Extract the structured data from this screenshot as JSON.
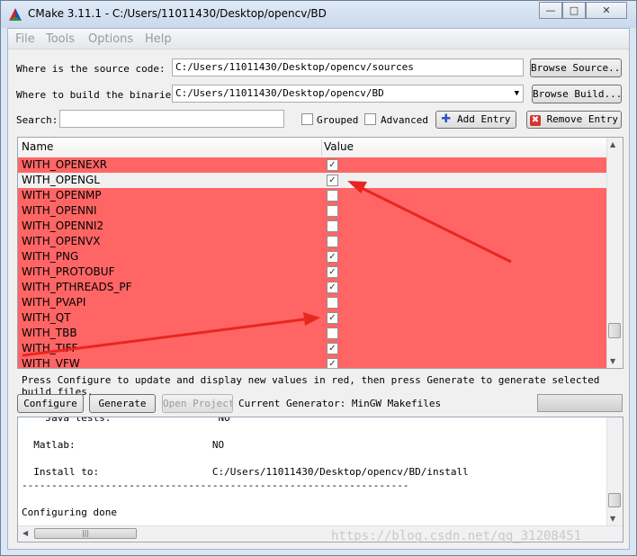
{
  "window": {
    "title": "CMake 3.11.1 - C:/Users/11011430/Desktop/opencv/BD",
    "controls": [
      "—",
      "□",
      "✕"
    ]
  },
  "menu": [
    "File",
    "Tools",
    "Options",
    "Help"
  ],
  "paths": {
    "source_label": "Where is the source code:",
    "source_value": "C:/Users/11011430/Desktop/opencv/sources",
    "browse_source": "Browse Source...",
    "build_label": "Where to build the binaries:",
    "build_value": "C:/Users/11011430/Desktop/opencv/BD",
    "browse_build": "Browse Build..."
  },
  "search": {
    "label": "Search:",
    "value": "",
    "grouped_label": "Grouped",
    "grouped_checked": false,
    "advanced_label": "Advanced",
    "advanced_checked": false,
    "add_entry": "Add Entry",
    "remove_entry": "Remove Entry"
  },
  "table": {
    "headers": [
      "Name",
      "Value"
    ],
    "rows": [
      {
        "name": "WITH_OPENEXR",
        "checked": true
      },
      {
        "name": "WITH_OPENGL",
        "checked": true,
        "selected": true
      },
      {
        "name": "WITH_OPENMP",
        "checked": false
      },
      {
        "name": "WITH_OPENNI",
        "checked": false
      },
      {
        "name": "WITH_OPENNI2",
        "checked": false
      },
      {
        "name": "WITH_OPENVX",
        "checked": false
      },
      {
        "name": "WITH_PNG",
        "checked": true
      },
      {
        "name": "WITH_PROTOBUF",
        "checked": true
      },
      {
        "name": "WITH_PTHREADS_PF",
        "checked": true
      },
      {
        "name": "WITH_PVAPI",
        "checked": false
      },
      {
        "name": "WITH_QT",
        "checked": true
      },
      {
        "name": "WITH_TBB",
        "checked": false
      },
      {
        "name": "WITH_TIFF",
        "checked": true
      },
      {
        "name": "WITH_VFW",
        "checked": true
      }
    ]
  },
  "hint": "Press Configure to update and display new values in red, then press Generate to generate selected build files.",
  "actions": {
    "configure": "Configure",
    "generate": "Generate",
    "open_project": "Open Project",
    "generator": "Current Generator: MinGW Makefiles"
  },
  "output_lines": [
    "    Java tests:                  NO",
    "",
    "  Matlab:                       NO",
    "",
    "  Install to:                   C:/Users/11011430/Desktop/opencv/BD/install",
    "-----------------------------------------------------------------",
    "",
    "Configuring done"
  ],
  "watermark": "https://blog.csdn.net/qq_31208451",
  "colors": {
    "changed_row": "#ff6565",
    "arrow": "#e8261f"
  }
}
